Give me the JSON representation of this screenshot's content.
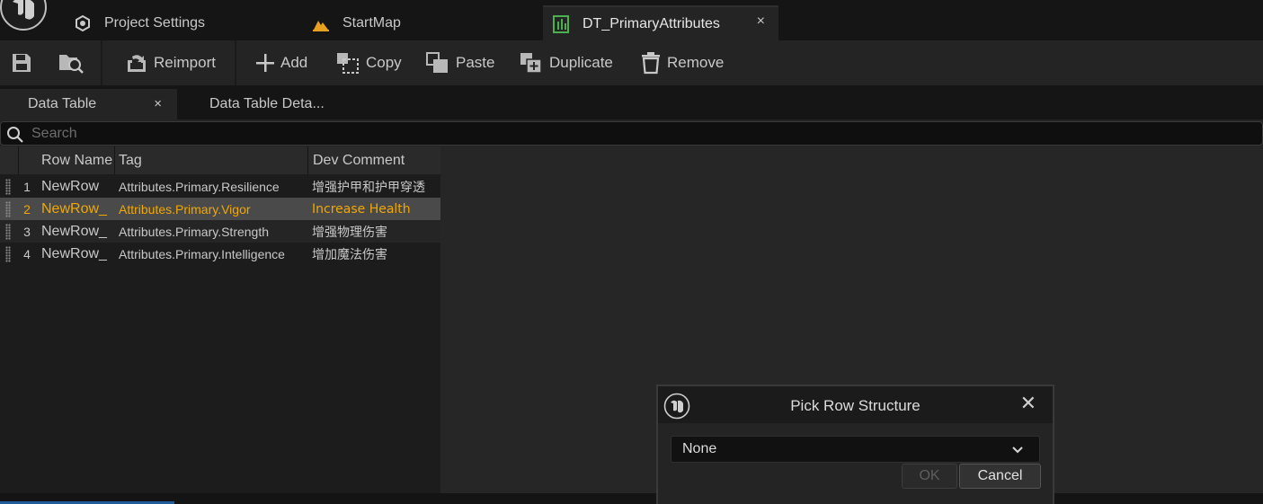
{
  "tabs": {
    "project_settings": "Project Settings",
    "startmap": "StartMap",
    "datatable": "DT_PrimaryAttributes",
    "close_glyph": "×"
  },
  "toolbar": {
    "reimport": "Reimport",
    "add": "Add",
    "copy": "Copy",
    "paste": "Paste",
    "duplicate": "Duplicate",
    "remove": "Remove"
  },
  "subtabs": {
    "datatable": "Data Table",
    "details": "Data Table Deta...",
    "close_glyph": "×"
  },
  "search": {
    "placeholder": "Search"
  },
  "table": {
    "headers": {
      "row_name": "Row Name",
      "tag": "Tag",
      "dev_comment": "Dev Comment"
    },
    "rows": [
      {
        "index": "1",
        "row_name": "NewRow",
        "tag": "Attributes.Primary.Resilience",
        "comment": "增强护甲和护甲穿透"
      },
      {
        "index": "2",
        "row_name": "NewRow_",
        "tag": "Attributes.Primary.Vigor",
        "comment": "Increase Health"
      },
      {
        "index": "3",
        "row_name": "NewRow_",
        "tag": "Attributes.Primary.Strength",
        "comment": "增强物理伤害"
      },
      {
        "index": "4",
        "row_name": "NewRow_",
        "tag": "Attributes.Primary.Intelligence",
        "comment": "增加魔法伤害"
      }
    ]
  },
  "dialog": {
    "title": "Pick Row Structure",
    "close_glyph": "✕",
    "selected_structure": "None",
    "ok": "OK",
    "cancel": "Cancel"
  },
  "colors": {
    "selected_row_text": "#f0a800",
    "startmap_icon": "#e8a020",
    "datatable_icon": "#4caf50"
  }
}
